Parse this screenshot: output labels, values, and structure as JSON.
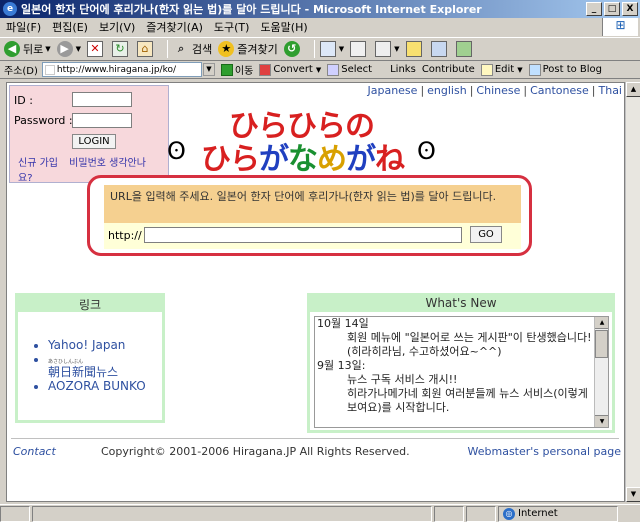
{
  "window": {
    "title": "일본어 한자 단어에 후리가나(한자 읽는 법)를 달아 드립니다 - Microsoft Internet Explorer",
    "buttons": {
      "minimize": "_",
      "maximize": "□",
      "close": "X"
    }
  },
  "menu": [
    "파일(F)",
    "편집(E)",
    "보기(V)",
    "즐겨찾기(A)",
    "도구(T)",
    "도움말(H)"
  ],
  "toolbar": {
    "back": "뒤로",
    "search": "검색",
    "favorites": "즐겨찾기"
  },
  "address": {
    "label": "주소(D)",
    "url": "http://www.hiragana.jp/ko/",
    "go": "이동",
    "convert": "Convert",
    "select": "Select",
    "links": "Links",
    "contribute": "Contribute",
    "edit": "Edit",
    "post": "Post to Blog"
  },
  "login": {
    "id_label": "ID :",
    "password_label": "Password :",
    "button": "LOGIN",
    "signup": "신규 가입",
    "forgot": "비밀번호 생각안나요?"
  },
  "languages": [
    "Japanese",
    "english",
    "Chinese",
    "Cantonese",
    "Thai"
  ],
  "logo": {
    "line1": "ひらひらの",
    "line2_parts": [
      "ひら",
      "が",
      "な",
      "め",
      "が",
      "ね"
    ]
  },
  "url_panel": {
    "message": "URL을 입력해 주세요. 일본어 한자 단어에 후리가나(한자 읽는 법)를 달아 드립니다.",
    "prefix": "http://",
    "go_button": "GO"
  },
  "links_panel": {
    "header": "링크",
    "items": [
      {
        "label": "Yahoo! Japan",
        "ruby": ""
      },
      {
        "label": "朝日新聞뉴스",
        "ruby": "あさひしんぶん"
      },
      {
        "label": "AOZORA BUNKO",
        "ruby": ""
      }
    ]
  },
  "news_panel": {
    "header": "What's New",
    "entries": [
      {
        "date": "10월 14일",
        "lines": [
          "회원 메뉴에 \"일본어로 쓰는 게시판\"이 탄생했습니다!",
          "(히라히라님, 수고하셨어요~^^)"
        ]
      },
      {
        "date": "9월 13일:",
        "lines": [
          "뉴스 구독 서비스 개시!!",
          "히라가나메가네 회원 여러분들께 뉴스 서비스(이렇게 보여요)를 시작합니다."
        ]
      }
    ]
  },
  "footer": {
    "contact": "Contact",
    "copyright": "Copyright© 2001-2006 Hiragana.JP All Rights Reserved.",
    "webmaster": "Webmaster's personal page"
  },
  "status": {
    "zone": "Internet"
  }
}
